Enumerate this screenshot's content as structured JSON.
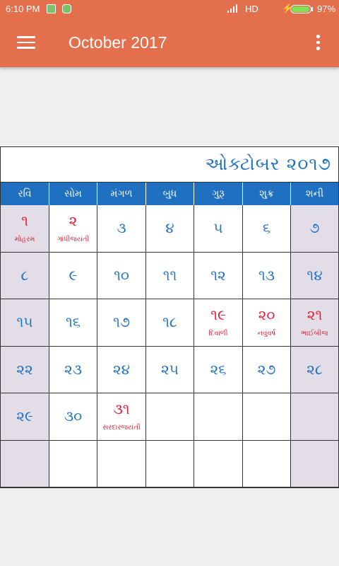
{
  "status_bar": {
    "time": "6:10 PM",
    "network": "HD",
    "charge_glyph": "⚡",
    "battery_percent": "97%",
    "battery_level": 0.97
  },
  "app_bar": {
    "title": "October 2017",
    "menu_icon": "menu-icon",
    "overflow_icon": "more-vert-icon"
  },
  "calendar": {
    "header": "ઓક્ટોબર ૨૦૧૭",
    "weekdays": [
      "રવિ",
      "સોમ",
      "મંગળ",
      "બુધ",
      "ગુરૂ",
      "શુક્ર",
      "શની"
    ],
    "cells": [
      {
        "date": "૧",
        "event": "મોહરમ",
        "holiday": true
      },
      {
        "date": "૨",
        "event": "ગાંધીજયંતી",
        "holiday": true
      },
      {
        "date": "૩"
      },
      {
        "date": "૪"
      },
      {
        "date": "૫"
      },
      {
        "date": "૬"
      },
      {
        "date": "૭"
      },
      {
        "date": "૮"
      },
      {
        "date": "૯"
      },
      {
        "date": "૧૦"
      },
      {
        "date": "૧૧"
      },
      {
        "date": "૧૨"
      },
      {
        "date": "૧૩"
      },
      {
        "date": "૧૪"
      },
      {
        "date": "૧૫"
      },
      {
        "date": "૧૬"
      },
      {
        "date": "૧૭"
      },
      {
        "date": "૧૮"
      },
      {
        "date": "૧૯",
        "event": "દિવાળી",
        "holiday": true
      },
      {
        "date": "૨૦",
        "event": "નવુંવર્ષ",
        "holiday": true
      },
      {
        "date": "૨૧",
        "event": "ભાઈબીજ",
        "holiday": true
      },
      {
        "date": "૨૨"
      },
      {
        "date": "૨૩"
      },
      {
        "date": "૨૪"
      },
      {
        "date": "૨૫"
      },
      {
        "date": "૨૬"
      },
      {
        "date": "૨૭"
      },
      {
        "date": "૨૮"
      },
      {
        "date": "૨૯"
      },
      {
        "date": "૩૦"
      },
      {
        "date": "૩૧",
        "event": "સરદારજયંતી",
        "holiday": true
      },
      {
        "date": ""
      },
      {
        "date": ""
      },
      {
        "date": ""
      },
      {
        "date": ""
      },
      {
        "date": ""
      },
      {
        "date": ""
      },
      {
        "date": ""
      },
      {
        "date": ""
      },
      {
        "date": ""
      },
      {
        "date": ""
      },
      {
        "date": ""
      }
    ]
  },
  "colors": {
    "accent": "#e36f4c",
    "weekday_bar": "#1f70c1",
    "date_text": "#1f70c1",
    "holiday_text": "#e5192f",
    "weekend_cell": "#e3dde8"
  }
}
